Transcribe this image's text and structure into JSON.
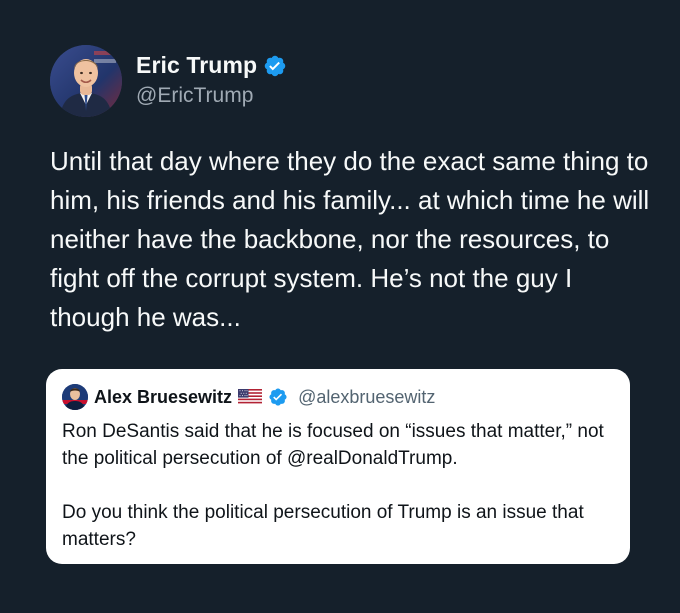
{
  "tweet": {
    "author": {
      "display_name": "Eric Trump",
      "handle": "@EricTrump",
      "verified": true
    },
    "text": "Until that day where they do the exact same thing to him, his friends and his family... at which time he will neither have the backbone, nor the resources, to fight off the corrupt system. He’s not the guy I though he was...",
    "quoted": {
      "author": {
        "display_name": "Alex Bruesewitz",
        "handle": "@alexbruesewitz",
        "verified": true,
        "flag": "us-flag-icon"
      },
      "paragraphs": [
        "Ron DeSantis said that he is focused on “issues that matter,” not the political persecution of @realDonaldTrump.",
        "Do you think the political persecution of Trump is an issue that matters?"
      ]
    }
  },
  "colors": {
    "background": "#15202b",
    "verified_blue": "#1d9bf0",
    "quote_background": "#ffffff",
    "handle_gray_dark": "#a0aab4",
    "handle_gray_light": "#536471"
  }
}
